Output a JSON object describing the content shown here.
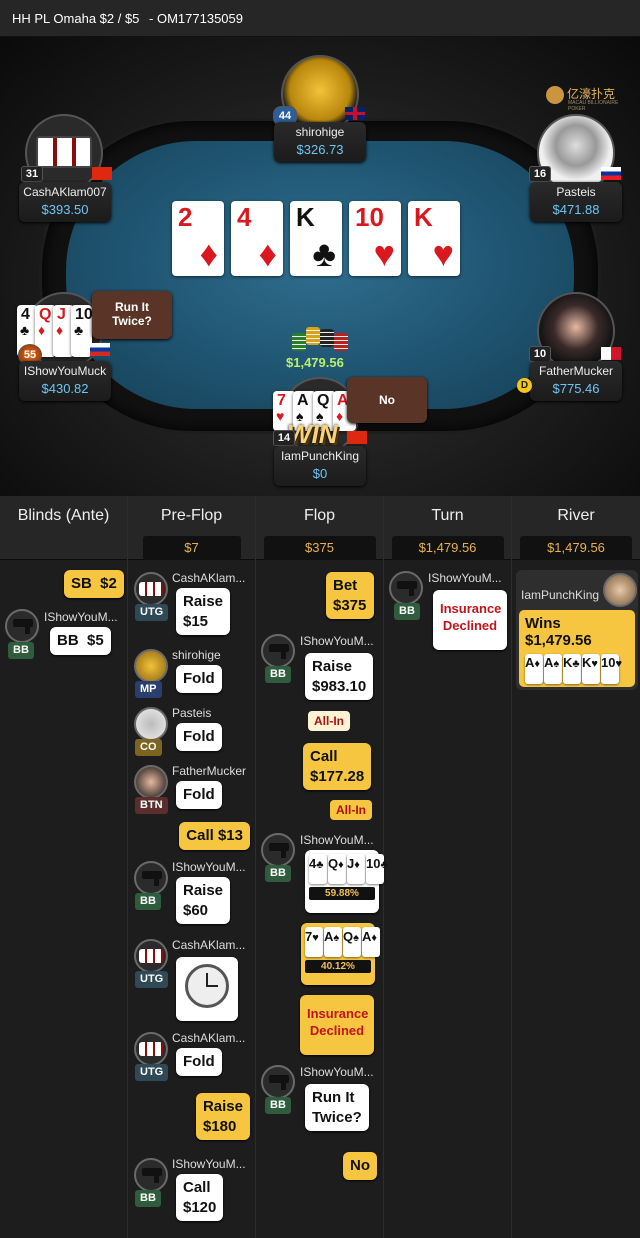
{
  "header": {
    "title": "HH PL Omaha $2 / $5",
    "hand_id": "- OM177135059"
  },
  "brand": {
    "name": "亿濠扑克",
    "tagline": "MACAU BILLIONAIRE POKER"
  },
  "board": [
    {
      "rank": "2",
      "suit": "♦",
      "color": "red"
    },
    {
      "rank": "4",
      "suit": "♦",
      "color": "red"
    },
    {
      "rank": "K",
      "suit": "♣",
      "color": "black"
    },
    {
      "rank": "10",
      "suit": "♥",
      "color": "red"
    },
    {
      "rank": "K",
      "suit": "♥",
      "color": "red"
    }
  ],
  "pot": "$1,479.56",
  "seats": {
    "shirohige": {
      "name": "shirohige",
      "stack": "$326.73",
      "level": "44"
    },
    "cashaklam": {
      "name": "CashAKlam007",
      "stack": "$393.50",
      "level": "31"
    },
    "pasteis": {
      "name": "Pasteis",
      "stack": "$471.88",
      "level": "16"
    },
    "ishowyoumuck": {
      "name": "IShowYouMuck",
      "stack": "$430.82",
      "level": "55",
      "bubble": "Run It Twice?",
      "cards": [
        {
          "rank": "4",
          "suit": "♣",
          "color": "black"
        },
        {
          "rank": "Q",
          "suit": "♦",
          "color": "red"
        },
        {
          "rank": "J",
          "suit": "♦",
          "color": "red"
        },
        {
          "rank": "10",
          "suit": "♣",
          "color": "black"
        }
      ]
    },
    "fathermucker": {
      "name": "FatherMucker",
      "stack": "$775.46",
      "level": "10",
      "dealer": "D"
    },
    "hero": {
      "name": "IamPunchKing",
      "stack": "$0",
      "level": "14",
      "bubble": "No",
      "win_text": "WIN",
      "cards": [
        {
          "rank": "7",
          "suit": "♥",
          "color": "red"
        },
        {
          "rank": "A",
          "suit": "♠",
          "color": "black"
        },
        {
          "rank": "Q",
          "suit": "♠",
          "color": "black"
        },
        {
          "rank": "A",
          "suit": "♦",
          "color": "red"
        }
      ]
    }
  },
  "streets": [
    {
      "label": "Blinds (Ante)",
      "amount": ""
    },
    {
      "label": "Pre-Flop",
      "amount": "$7"
    },
    {
      "label": "Flop",
      "amount": "$375"
    },
    {
      "label": "Turn",
      "amount": "$1,479.56"
    },
    {
      "label": "River",
      "amount": "$1,479.56"
    }
  ],
  "blinds": {
    "sb": "SB  $2",
    "bb_player": "IShowYouM...",
    "bb_pos": "BB",
    "bb_action": "BB  $5"
  },
  "preflop": [
    {
      "player": "CashAKlam...",
      "pos": "UTG",
      "action": "Raise\n$15"
    },
    {
      "player": "shirohige",
      "pos": "MP",
      "action": "Fold"
    },
    {
      "player": "Pasteis",
      "pos": "CO",
      "action": "Fold"
    },
    {
      "player": "FatherMucker",
      "pos": "BTN",
      "action": "Fold"
    },
    {
      "hero_action": "Call  $13"
    },
    {
      "player": "IShowYouM...",
      "pos": "BB",
      "action": "Raise\n$60"
    },
    {
      "player": "CashAKlam...",
      "pos": "UTG",
      "action": "timeout"
    },
    {
      "player": "CashAKlam...",
      "pos": "UTG",
      "action": "Fold"
    },
    {
      "hero_action": "Raise\n$180"
    },
    {
      "player": "IShowYouM...",
      "pos": "BB",
      "action": "Call\n$120"
    }
  ],
  "flop": {
    "hero_bet": "Bet\n$375",
    "villain": "IShowYouM...",
    "villain_pos": "BB",
    "villain_raise": "Raise\n$983.10",
    "allin": "All-In",
    "hero_call": "Call\n$177.28",
    "hero_allin": "All-In",
    "villain2": "IShowYouM...",
    "villain2_pos": "BB",
    "villain_equity": "59.88%",
    "hero_equity": "40.12%",
    "insurance": "Insurance\nDeclined",
    "villain3": "IShowYouM...",
    "villain3_pos": "BB",
    "rit_question": "Run It\nTwice?",
    "rit_answer": "No"
  },
  "turn": {
    "player": "IShowYouM...",
    "pos": "BB",
    "action": "Insurance\nDeclined"
  },
  "river": {
    "winner": "IamPunchKing",
    "wins": "Wins $1,479.56",
    "cards": [
      {
        "rank": "A",
        "suit": "♦",
        "color": "red"
      },
      {
        "rank": "A",
        "suit": "♠",
        "color": "black"
      },
      {
        "rank": "K",
        "suit": "♣",
        "color": "black"
      },
      {
        "rank": "K",
        "suit": "♥",
        "color": "red"
      },
      {
        "rank": "10",
        "suit": "♥",
        "color": "red"
      }
    ]
  }
}
